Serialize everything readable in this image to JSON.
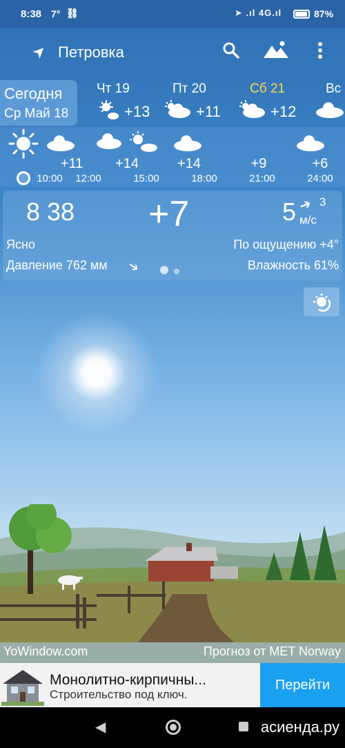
{
  "status_bar": {
    "time": "8:38",
    "temp": "7°",
    "link": "⛓",
    "signal": "➤ .ıl 4G.ıl",
    "battery_pct": "87%"
  },
  "header": {
    "location": "Петровка"
  },
  "days": [
    {
      "name": "Сегодня",
      "date": "Ср Май 18"
    },
    {
      "name": "Чт 19",
      "temp": "+13",
      "icon": "sun-cloud-icon"
    },
    {
      "name": "Пт 20",
      "temp": "+11",
      "icon": "cloud-sun-icon"
    },
    {
      "name": "Сб 21",
      "temp": "+12",
      "icon": "cloud-sun-icon",
      "highlight": "#ffd34d"
    },
    {
      "name": "Вс",
      "icon": "cloud-icon"
    }
  ],
  "hourly": [
    {
      "time": "10:00",
      "temp": "",
      "icon": "sun-icon"
    },
    {
      "time": "12:00",
      "temp": "+11",
      "icon": "cloud-icon"
    },
    {
      "time": "15:00",
      "temp": "+14",
      "icon": "cloud-sun-icon"
    },
    {
      "time": "18:00",
      "temp": "+14",
      "icon": "cloud-icon"
    },
    {
      "time": "21:00",
      "temp": "+9",
      "icon": ""
    },
    {
      "time": "24:00",
      "temp": "+6",
      "icon": "cloud-icon"
    }
  ],
  "current": {
    "time": "8 38",
    "temp": "+7",
    "wind_speed": "5",
    "wind_gust": "3",
    "wind_unit": "м/с",
    "condition": "Ясно",
    "feels_like": "По ощущению +4°",
    "pressure": "Давление 762 мм",
    "humidity": "Влажность 61%"
  },
  "footer": {
    "site": "YoWindow.com",
    "provider": "Прогноз от MET Norway"
  },
  "ad": {
    "title": "Монолитно-кирпичны...",
    "subtitle": "Строительство под ключ.",
    "button": "Перейти"
  },
  "watermark": "асиенда.ру",
  "colors": {
    "accent": "#1aa1f2",
    "sky_top": "#2f6fb3",
    "saturday": "#ffd34d"
  }
}
